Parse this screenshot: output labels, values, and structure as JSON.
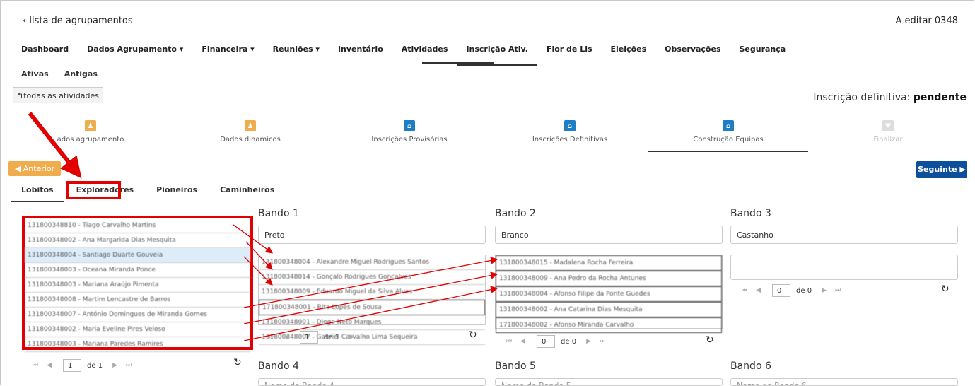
{
  "header": {
    "back_link": "lista de agrupamentos",
    "editing": "A editar 0348"
  },
  "nav": [
    {
      "label": "Dashboard"
    },
    {
      "label": "Dados Agrupamento ▾"
    },
    {
      "label": "Financeira ▾"
    },
    {
      "label": "Reuniões ▾"
    },
    {
      "label": "Inventário"
    },
    {
      "label": "Atividades"
    },
    {
      "label": "Inscrição Ativ."
    },
    {
      "label": "Flor de Lis"
    },
    {
      "label": "Eleições"
    },
    {
      "label": "Observações"
    },
    {
      "label": "Segurança"
    }
  ],
  "subtabs": {
    "active": "Ativas",
    "other": "Antigas"
  },
  "all_activities_button": "todas as atividades",
  "status": {
    "label": "Inscrição definitiva:",
    "value": "pendente"
  },
  "steps": [
    {
      "label": "ados agrupamento"
    },
    {
      "label": "Dados dinamicos"
    },
    {
      "label": "Inscrições Provisórias"
    },
    {
      "label": "Inscrições Definitivas"
    },
    {
      "label": "Construção Equipas"
    },
    {
      "label": "Finalizar"
    }
  ],
  "prev_button": "Anterior",
  "next_button": "Seguinte",
  "section_tabs": [
    "Lobitos",
    "Exploradores",
    "Pioneiros",
    "Caminheiros"
  ],
  "source_list": [
    "131800348810 - Tiago Carvalho Martins",
    "131800348002 - Ana Margarida Dias Mesquita",
    "131800348004 - Santiago Duarte Gouveia",
    "131800348003 - Oceana Miranda Ponce",
    "131800348003 - Mariana Araújo Pimenta",
    "131800348008 - Martim Lencastre de Barros",
    "131800348007 - António Domingues de Miranda Gomes",
    "131800348002 - Maria Eveline Pires Veloso",
    "131800348003 - Mariana Paredes Ramires"
  ],
  "source_pager": {
    "page": "1",
    "of": "de 1"
  },
  "bandos": [
    {
      "title": "Bando 1",
      "name": "Preto",
      "members": [
        "131800348004 - Alexandre Miguel Rodrigues Santos",
        "131800348014 - Gonçalo Rodrigues Gonçalves",
        "131800348009 - Eduardo Miguel da Silva Alves",
        "171800348001 - Rita Lopes de Sousa",
        "131800348001 - Diogo Neto Marques",
        "131800348007 - Gabriel Carvalho Lima Sequeira"
      ],
      "pager": {
        "page": "1",
        "of": "de 1"
      }
    },
    {
      "title": "Bando 2",
      "name": "Branco",
      "members": [
        "131800348015 - Madalena Rocha Ferreira",
        "131800348009 - Ana Pedro da Rocha Antunes",
        "131800348004 - Afonso Filipe da Ponte Guedes",
        "131800348002 - Ana Catarina Dias Mesquita",
        "171800348002 - Afonso Miranda Carvalho"
      ],
      "pager": {
        "page": "0",
        "of": "de 0"
      }
    },
    {
      "title": "Bando 3",
      "name": "Castanho",
      "members": [],
      "pager": {
        "page": "0",
        "of": "de 0"
      }
    },
    {
      "title": "Bando 4",
      "name": "Nome do Bando 4"
    },
    {
      "title": "Bando 5",
      "name": "Nome do Bando 5"
    },
    {
      "title": "Bando 6",
      "name": "Nome do Bando 6"
    }
  ],
  "colors": {
    "highlight_red": "#e30000",
    "orange": "#f0ad4e",
    "blue": "#1d7ec3",
    "navy": "#0e4f9b"
  }
}
